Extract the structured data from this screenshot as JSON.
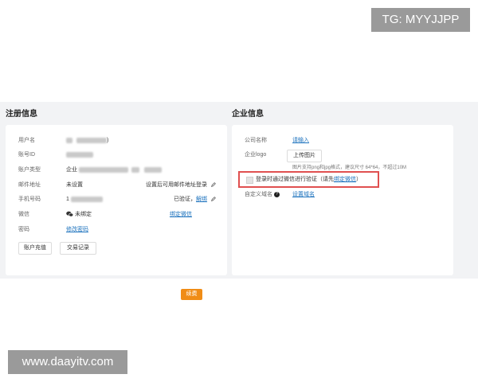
{
  "badge": "TG: MYYJJPP",
  "watermark": "www.daayitv.com",
  "registration": {
    "title": "注册信息",
    "username_label": "用户名",
    "username_value_end": ")",
    "account_id_label": "账号ID",
    "account_type_label": "账户类型",
    "account_type_value": "企业",
    "renew_label": "续费",
    "email_label": "邮件地址",
    "email_value": "未设置",
    "email_action": "设置后可用邮件地址登录",
    "phone_label": "手机号码",
    "phone_value": "1",
    "phone_status": "已验证，",
    "phone_unbind": "解绑",
    "wechat_label": "微信",
    "wechat_value": "未绑定",
    "wechat_action": "绑定微信",
    "password_label": "密码",
    "password_action": "修改密码",
    "recharge_button": "账户充值",
    "records_button": "交易记录"
  },
  "company": {
    "title": "企业信息",
    "name_label": "公司名称",
    "name_action": "请输入",
    "logo_label": "企业logo",
    "upload_button": "上传图片",
    "logo_hint": "图片支持png和jpg格式，建议尺寸 64*64，不超过10M",
    "wechat_verify_text": "登录时通过微信进行验证（请先",
    "wechat_verify_link": "绑定微信",
    "wechat_verify_end": "）",
    "domain_label": "自定义域名",
    "domain_action": "设置域名"
  },
  "colors": {
    "accent": "#1e73be",
    "orange": "#f08c16",
    "highlight": "#e05050",
    "background": "#f2f3f5"
  }
}
